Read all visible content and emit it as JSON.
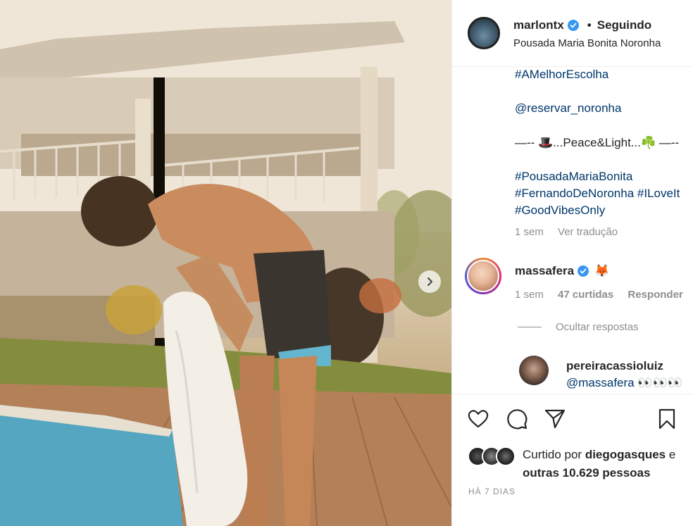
{
  "post": {
    "username": "marlontx",
    "follow_separator": "•",
    "follow_state": "Seguindo",
    "location": "Pousada Maria Bonita Noronha",
    "verified_color": "#3897f0",
    "link_color": "#00376b"
  },
  "caption": {
    "lines": [
      "#AMelhorEscolha",
      "@reservar_noronha",
      "—-- 🎩...Peace&Light...☘️ —--",
      "#PousadaMariaBonita",
      "#FernandoDeNoronha #ILoveIt",
      "#GoodVibesOnly"
    ],
    "time": "1 sem",
    "translate": "Ver tradução"
  },
  "comments": [
    {
      "username": "massafera",
      "emoji": "🦊",
      "time": "1 sem",
      "likes": "47 curtidas",
      "reply": "Responder",
      "hide_replies": "Ocultar respostas"
    },
    {
      "username": "pereiracassioluiz",
      "text": "@massafera 👀👀👀"
    }
  ],
  "likes": {
    "prefix": "Curtido por ",
    "user": "diegogasques",
    "conjunction": " e",
    "others": "outras 10.629 pessoas"
  },
  "timestamp": "HÁ 7 DIAS",
  "icons": [
    "heart-icon",
    "comment-icon",
    "share-icon",
    "bookmark-icon",
    "chevron-right-icon",
    "verified-icon"
  ]
}
